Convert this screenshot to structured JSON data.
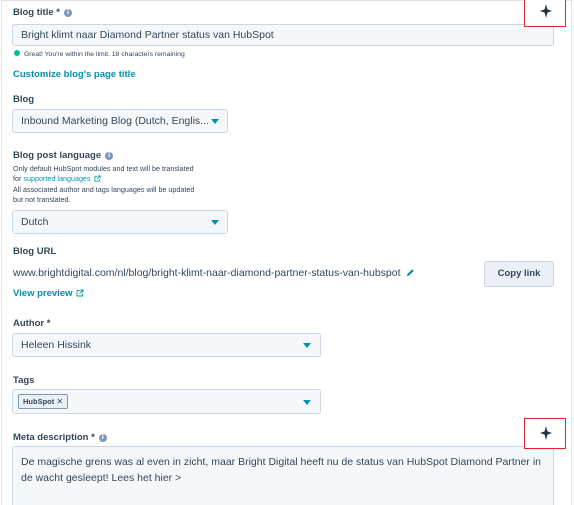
{
  "blog_title": {
    "label": "Blog title *",
    "value": "Bright klimt naar Diamond Partner status van HubSpot",
    "hint": "Great! You're within the limit. 18 characters remaining",
    "hint_color": "#00bda5",
    "customize_link": "Customize blog's page title",
    "ai_icon": "sparkle-icon"
  },
  "blog": {
    "label": "Blog",
    "selected": "Inbound Marketing Blog (Dutch, Englis..."
  },
  "language": {
    "label": "Blog post language",
    "note_line1": "Only default HubSpot modules and text will be translated",
    "note_line2_prefix": "for",
    "note_link": "supported languages",
    "note_line3": "All associated author and tags languages will be updated",
    "note_line4": "but not translated.",
    "selected": "Dutch"
  },
  "blog_url": {
    "label": "Blog URL",
    "url": "www.brightdigital.com/nl/blog/bright-klimt-naar-diamond-partner-status-van-hubspot",
    "copy_button": "Copy link",
    "preview_link": "View preview"
  },
  "author": {
    "label": "Author *",
    "selected": "Heleen Hissink"
  },
  "tags": {
    "label": "Tags",
    "items": [
      "HubSpot"
    ],
    "remove_symbol": "✕"
  },
  "meta": {
    "label": "Meta description *",
    "value": "De magische grens was al even in zicht, maar Bright Digital heeft nu de status van HubSpot Diamond Partner in de wacht gesleept! Lees het hier >",
    "ai_icon": "sparkle-icon"
  },
  "colors": {
    "accent": "#0091ae",
    "highlight_box": "#e0262b",
    "text": "#33475b"
  }
}
